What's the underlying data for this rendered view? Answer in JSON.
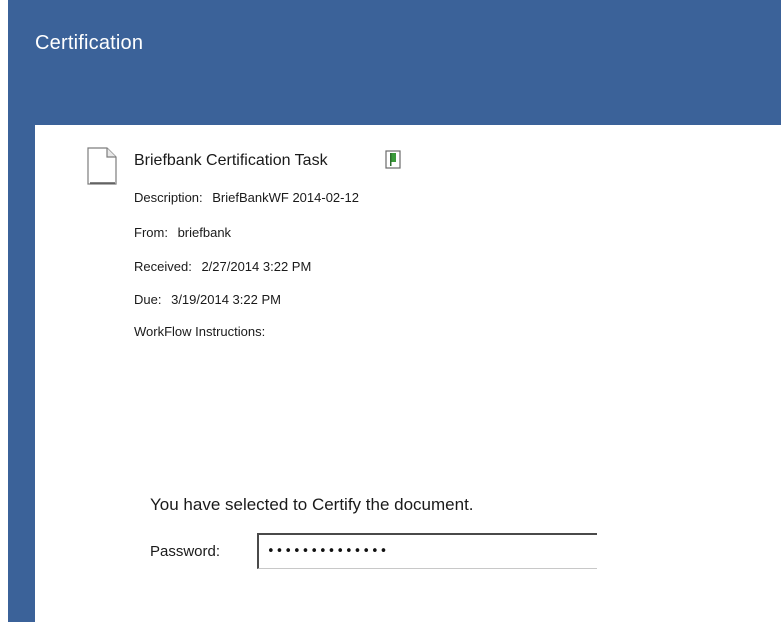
{
  "window": {
    "title": "Certification"
  },
  "task": {
    "title": "Briefbank Certification Task",
    "description_label": "Description:",
    "description_value": "BriefBankWF 2014-02-12",
    "from_label": "From:",
    "from_value": "briefbank",
    "received_label": "Received:",
    "received_value": "2/27/2014 3:22 PM",
    "due_label": "Due:",
    "due_value": "3/19/2014 3:22 PM",
    "instructions_label": "WorkFlow Instructions:"
  },
  "certify": {
    "message": "You have selected to Certify the document.",
    "password_label": "Password:",
    "password_value": "••••••••••••••"
  },
  "icons": {
    "document": "document-icon",
    "flag": "flag-icon"
  },
  "colors": {
    "header": "#3b6299",
    "background": "#ffffff"
  }
}
